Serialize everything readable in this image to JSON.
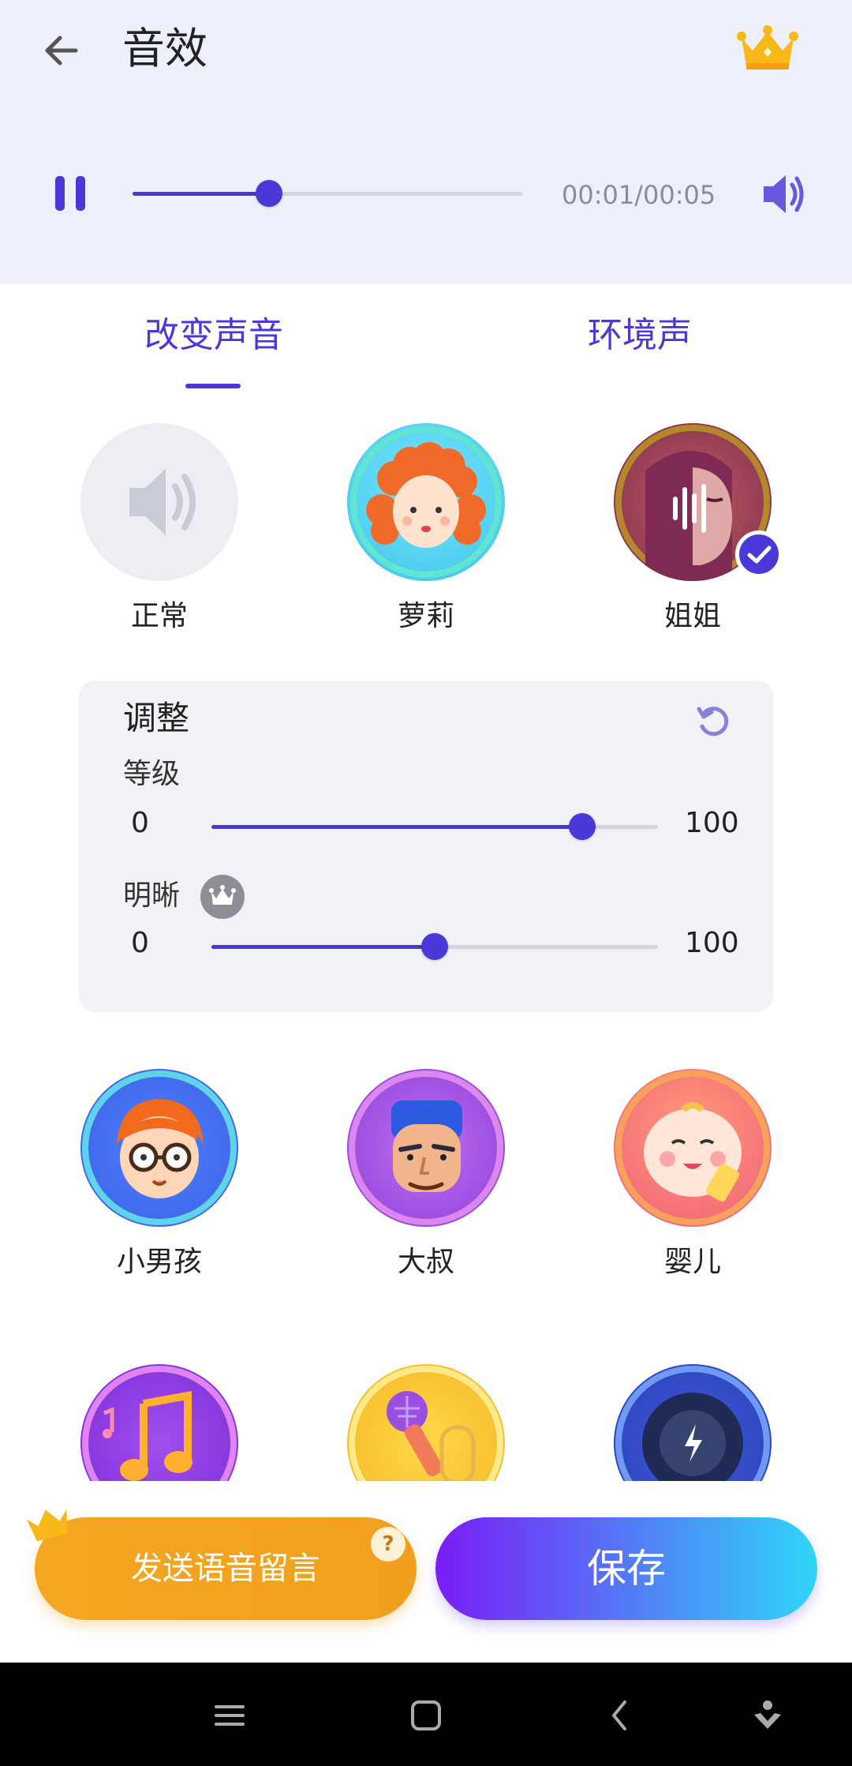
{
  "header": {
    "title": "音效"
  },
  "player": {
    "current_time": "00:01",
    "total_time": "00:05",
    "time_text": "00:01/00:05",
    "progress": 0.35
  },
  "tabs": [
    {
      "label": "改变声音",
      "active": true
    },
    {
      "label": "环境声",
      "active": false
    }
  ],
  "effects_row1": [
    {
      "label": "正常",
      "icon": "speaker-icon"
    },
    {
      "label": "萝莉",
      "icon": "curly-girl-avatar"
    },
    {
      "label": "姐姐",
      "icon": "woman-voice-avatar",
      "selected": true
    }
  ],
  "adjust": {
    "title": "调整",
    "level": {
      "label": "等级",
      "min": "0",
      "max": "100",
      "value": 83
    },
    "clarity": {
      "label": "明晰",
      "min": "0",
      "max": "100",
      "value": 50,
      "premium": true
    }
  },
  "effects_row2": [
    {
      "label": "小男孩",
      "icon": "boy-avatar"
    },
    {
      "label": "大叔",
      "icon": "uncle-avatar"
    },
    {
      "label": "婴儿",
      "icon": "baby-avatar"
    }
  ],
  "effects_row3": [
    {
      "icon": "music-note-avatar"
    },
    {
      "icon": "microphone-avatar"
    },
    {
      "icon": "speed-dial-avatar"
    }
  ],
  "actions": {
    "voice_message": "发送语音留言",
    "save": "保存",
    "help": "?"
  },
  "colors": {
    "accent": "#4a39d6",
    "header_bg": "#edf0fb",
    "orange": "#f4a621"
  }
}
